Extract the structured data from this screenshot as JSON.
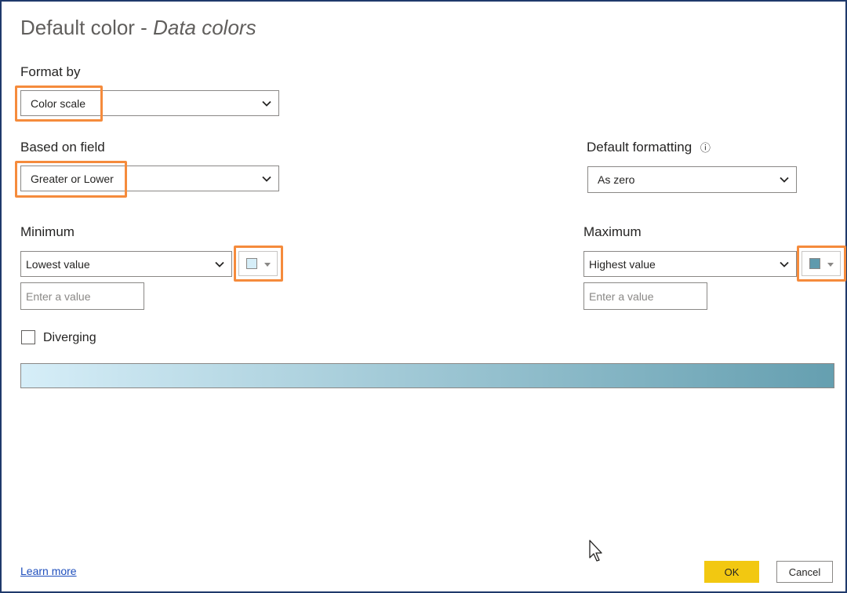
{
  "dialog": {
    "title_main": "Default color - ",
    "title_italic": "Data colors"
  },
  "format_by": {
    "label": "Format by",
    "selected": "Color scale"
  },
  "based_on_field": {
    "label": "Based on field",
    "selected": "Greater or Lower"
  },
  "default_formatting": {
    "label": "Default formatting",
    "info_glyph": "ⓘ",
    "selected": "As zero"
  },
  "minimum": {
    "label": "Minimum",
    "selected": "Lowest value",
    "placeholder": "Enter a value",
    "color": "#d6eef8"
  },
  "maximum": {
    "label": "Maximum",
    "selected": "Highest value",
    "placeholder": "Enter a value",
    "color": "#5f9aad"
  },
  "diverging": {
    "label": "Diverging",
    "checked": false
  },
  "gradient": {
    "start": "#d6eef8",
    "end": "#659fb0"
  },
  "footer": {
    "learn_more": "Learn more",
    "ok_label": "OK",
    "cancel_label": "Cancel"
  },
  "colors": {
    "highlight": "#f58b3c",
    "ok_button": "#f2c811",
    "link": "#1f4fbd"
  },
  "icons": [
    "chevron-down-icon",
    "info-icon",
    "caret-down-icon",
    "mouse-cursor-icon"
  ]
}
